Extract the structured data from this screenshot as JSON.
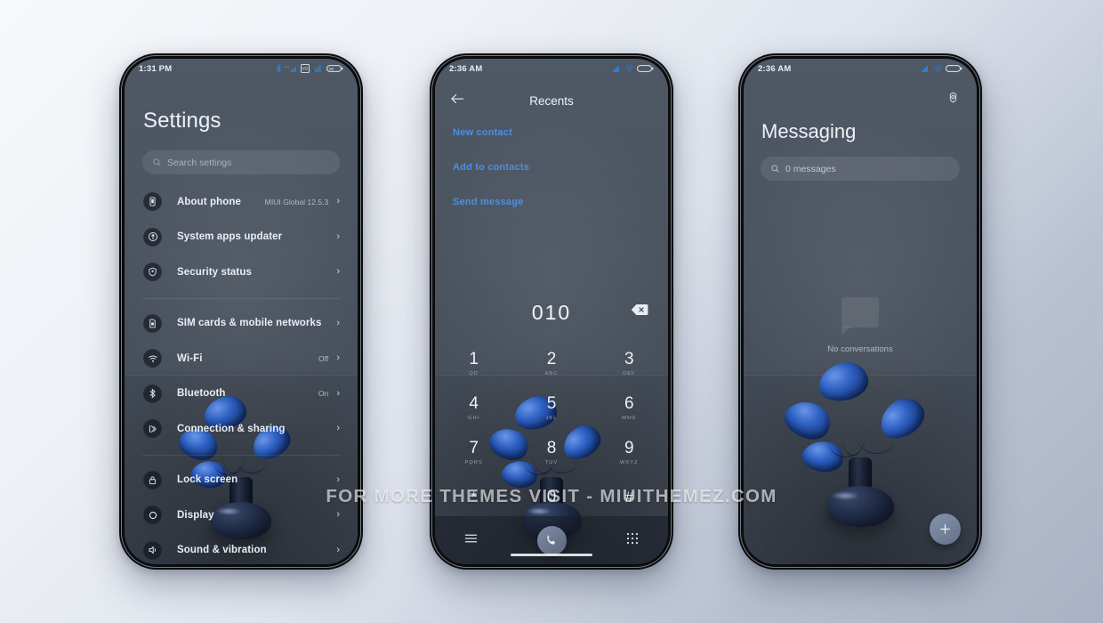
{
  "watermark": "FOR MORE THEMES VISIT - MIUITHEMEZ.COM",
  "theme": {
    "accent_blue": "#4a90e2",
    "screen_bg": "#4b5460",
    "text_primary": "#e9edf3",
    "text_secondary": "#aab2bf",
    "canvas_bg_start": "#f6f8fb",
    "canvas_bg_end": "#a9b2c4"
  },
  "phone1": {
    "status": {
      "time": "1:31 PM",
      "icons": [
        "bluetooth-icon",
        "4g-signal-icon",
        "volte-icon",
        "signal-bars-icon",
        "battery-icon"
      ],
      "battery_level": "65"
    },
    "title": "Settings",
    "search": {
      "placeholder": "Search settings",
      "icon": "search-icon"
    },
    "groups": [
      {
        "items": [
          {
            "icon": "phone-info-icon",
            "label": "About phone",
            "value": "MIUI Global 12.5.3",
            "chevron": "›"
          },
          {
            "icon": "updater-icon",
            "label": "System apps updater",
            "value": "",
            "chevron": "›"
          },
          {
            "icon": "shield-icon",
            "label": "Security status",
            "value": "",
            "chevron": "›"
          }
        ]
      },
      {
        "items": [
          {
            "icon": "sim-card-icon",
            "label": "SIM cards & mobile networks",
            "value": "",
            "chevron": "›"
          },
          {
            "icon": "wifi-icon",
            "label": "Wi-Fi",
            "value": "Off",
            "chevron": "›"
          },
          {
            "icon": "bluetooth-icon",
            "label": "Bluetooth",
            "value": "On",
            "chevron": "›"
          },
          {
            "icon": "connection-sharing-icon",
            "label": "Connection & sharing",
            "value": "",
            "chevron": "›"
          }
        ]
      },
      {
        "items": [
          {
            "icon": "lock-icon",
            "label": "Lock screen",
            "value": "",
            "chevron": "›"
          },
          {
            "icon": "display-icon",
            "label": "Display",
            "value": "",
            "chevron": "›"
          },
          {
            "icon": "sound-icon",
            "label": "Sound & vibration",
            "value": "",
            "chevron": "›"
          }
        ]
      }
    ]
  },
  "phone2": {
    "status": {
      "time": "2:36 AM",
      "icons": [
        "signal-bars-icon",
        "wifi-icon",
        "battery-icon"
      ]
    },
    "appbar": {
      "back_icon": "back-arrow-icon",
      "title": "Recents"
    },
    "actions": [
      {
        "label": "New contact"
      },
      {
        "label": "Add to contacts"
      },
      {
        "label": "Send message"
      }
    ],
    "dialed_number": "010",
    "delete_icon": "backspace-icon",
    "keys": [
      {
        "digit": "1",
        "sub": "QD"
      },
      {
        "digit": "2",
        "sub": "ABC"
      },
      {
        "digit": "3",
        "sub": "DEF"
      },
      {
        "digit": "4",
        "sub": "GHI"
      },
      {
        "digit": "5",
        "sub": "JKL"
      },
      {
        "digit": "6",
        "sub": "MNO"
      },
      {
        "digit": "7",
        "sub": "PQRS"
      },
      {
        "digit": "8",
        "sub": "TUV"
      },
      {
        "digit": "9",
        "sub": "WXYZ"
      },
      {
        "digit": "*",
        "sub": ""
      },
      {
        "digit": "0",
        "sub": "+"
      },
      {
        "digit": "#",
        "sub": ""
      }
    ],
    "bottombar": {
      "menu_icon": "hamburger-menu-icon",
      "call_icon": "phone-call-icon",
      "keypad_icon": "dialpad-grid-icon"
    }
  },
  "phone3": {
    "status": {
      "time": "2:36 AM",
      "icons": [
        "signal-bars-icon",
        "wifi-icon",
        "battery-icon"
      ]
    },
    "gear_icon": "gear-icon",
    "title": "Messaging",
    "search": {
      "placeholder": "0 messages",
      "icon": "search-icon"
    },
    "empty": {
      "icon": "speech-bubble-icon",
      "text": "No conversations"
    },
    "fab": {
      "icon": "plus-icon",
      "label": "+"
    }
  }
}
